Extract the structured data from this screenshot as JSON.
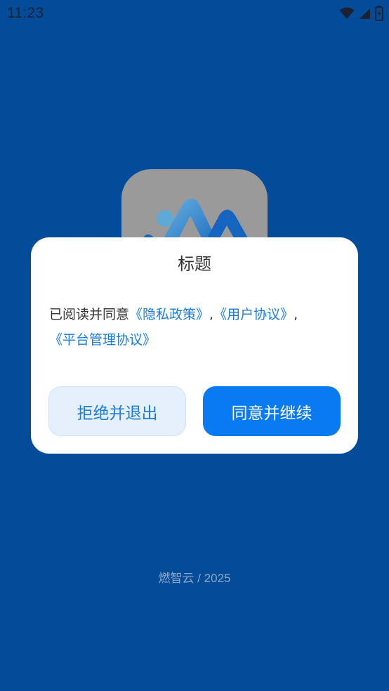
{
  "status_bar": {
    "time": "11:23",
    "icons": [
      "wifi-icon",
      "signal-icon",
      "battery-icon"
    ]
  },
  "app_icon": {
    "name": "app-logo",
    "colors": {
      "background": "#9a9a9a",
      "mark_light": "#5FA9D6",
      "mark_dark": "#1565C0"
    }
  },
  "dialog": {
    "title": "标题",
    "body_prefix": "已阅读并同意",
    "privacy_link": "《隐私政策》",
    "sep1": ",",
    "user_link": "《用户协议》",
    "sep2": ",",
    "platform_link": "《平台管理协议》",
    "reject_label": "拒绝并退出",
    "agree_label": "同意并继续"
  },
  "footer": {
    "text": "燃智云 / 2025"
  },
  "colors": {
    "background": "#034C9A",
    "accent": "#0A7AF3",
    "link": "#1A7CE0"
  }
}
